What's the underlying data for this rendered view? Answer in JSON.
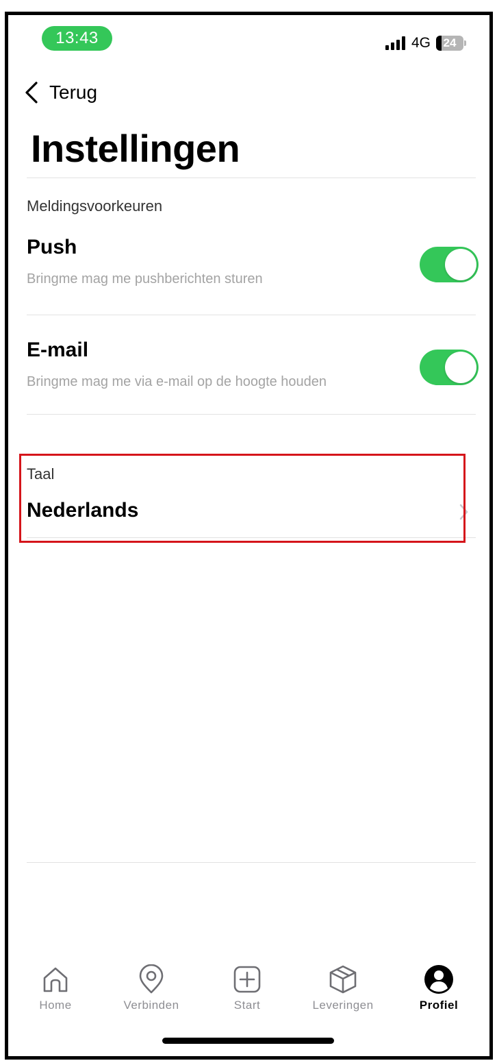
{
  "status_bar": {
    "time": "13:43",
    "network": "4G",
    "battery": "24"
  },
  "nav": {
    "back_label": "Terug"
  },
  "page": {
    "title": "Instellingen"
  },
  "notifications": {
    "section_label": "Meldingsvoorkeuren",
    "items": [
      {
        "title": "Push",
        "subtitle": "Bringme mag me pushberichten sturen",
        "enabled": true
      },
      {
        "title": "E-mail",
        "subtitle": "Bringme mag me via e-mail op de hoogte houden",
        "enabled": true
      }
    ]
  },
  "language": {
    "section_label": "Taal",
    "value": "Nederlands"
  },
  "tabbar": {
    "tabs": [
      {
        "label": "Home",
        "icon": "home-icon"
      },
      {
        "label": "Verbinden",
        "icon": "map-pin-icon"
      },
      {
        "label": "Start",
        "icon": "plus-square-icon"
      },
      {
        "label": "Leveringen",
        "icon": "package-icon"
      },
      {
        "label": "Profiel",
        "icon": "profile-icon",
        "active": true
      }
    ]
  },
  "colors": {
    "accent_green": "#34c759",
    "highlight_red": "#d5151b",
    "muted_text": "#a3a3a3"
  }
}
